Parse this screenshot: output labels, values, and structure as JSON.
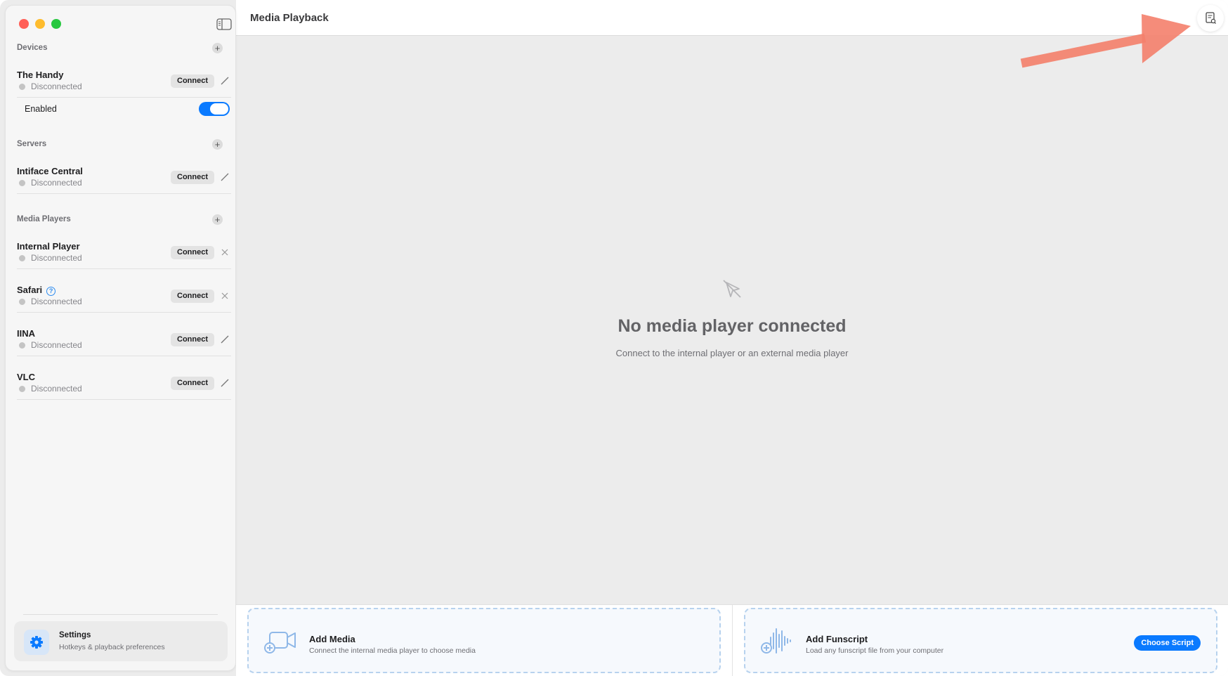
{
  "header": {
    "title": "Media Playback"
  },
  "sidebar": {
    "devices": {
      "title": "Devices",
      "items": [
        {
          "name": "The Handy",
          "status": "Disconnected",
          "connect_label": "Connect",
          "action_icon": "pencil-icon"
        }
      ],
      "enabled_label": "Enabled",
      "enabled": true
    },
    "servers": {
      "title": "Servers",
      "items": [
        {
          "name": "Intiface Central",
          "status": "Disconnected",
          "connect_label": "Connect",
          "action_icon": "pencil-icon"
        }
      ]
    },
    "media_players": {
      "title": "Media Players",
      "items": [
        {
          "name": "Internal Player",
          "status": "Disconnected",
          "connect_label": "Connect",
          "action_icon": "close-icon"
        },
        {
          "name": "Safari",
          "status": "Disconnected",
          "connect_label": "Connect",
          "action_icon": "close-icon",
          "help_icon": "?"
        },
        {
          "name": "IINA",
          "status": "Disconnected",
          "connect_label": "Connect",
          "action_icon": "pencil-icon"
        },
        {
          "name": "VLC",
          "status": "Disconnected",
          "connect_label": "Connect",
          "action_icon": "pencil-icon"
        }
      ]
    },
    "settings": {
      "title": "Settings",
      "subtitle": "Hotkeys & playback preferences"
    }
  },
  "main": {
    "empty_title": "No media player connected",
    "empty_subtitle": "Connect to the internal player or an external media player"
  },
  "bottom": {
    "add_media": {
      "title": "Add Media",
      "subtitle": "Connect the internal media player to choose media"
    },
    "add_funscript": {
      "title": "Add Funscript",
      "subtitle": "Load any funscript file from your computer",
      "button": "Choose Script"
    }
  },
  "colors": {
    "accent": "#0a7aff",
    "arrow": "#f4806b",
    "status_dot": "#c4c4c4"
  }
}
